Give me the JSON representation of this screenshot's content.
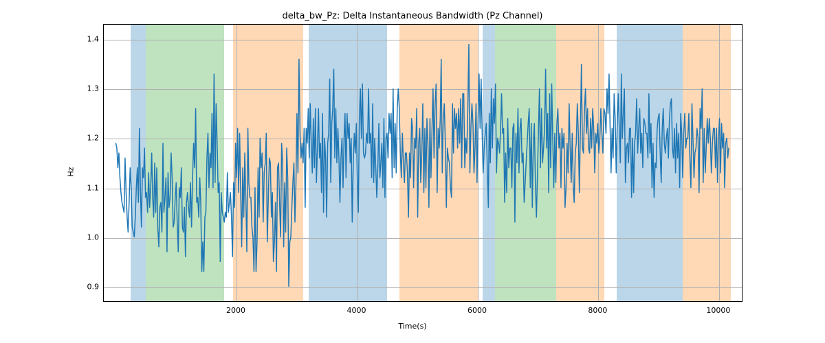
{
  "chart_data": {
    "type": "line",
    "title": "delta_bw_Pz: Delta Instantaneous Bandwidth (Pz Channel)",
    "xlabel": "Time(s)",
    "ylabel": "Hz",
    "xlim": [
      -200,
      10400
    ],
    "ylim": [
      0.87,
      1.43
    ],
    "x_ticks": [
      2000,
      4000,
      6000,
      8000,
      10000
    ],
    "y_ticks": [
      0.9,
      1.0,
      1.1,
      1.2,
      1.3,
      1.4
    ],
    "grid": true,
    "bands": [
      {
        "color": "#1f77b4",
        "x0": 250,
        "x1": 500
      },
      {
        "color": "#2ca02c",
        "x0": 500,
        "x1": 1800
      },
      {
        "color": "#ff7f0e",
        "x0": 1940,
        "x1": 3100
      },
      {
        "color": "#1f77b4",
        "x0": 3200,
        "x1": 4500
      },
      {
        "color": "#ff7f0e",
        "x0": 4700,
        "x1": 6000
      },
      {
        "color": "#1f77b4",
        "x0": 6080,
        "x1": 6280
      },
      {
        "color": "#2ca02c",
        "x0": 6280,
        "x1": 7300
      },
      {
        "color": "#ff7f0e",
        "x0": 7300,
        "x1": 8100
      },
      {
        "color": "#1f77b4",
        "x0": 8300,
        "x1": 9400
      },
      {
        "color": "#ff7f0e",
        "x0": 9400,
        "x1": 10200
      }
    ],
    "series": [
      {
        "name": "delta_bw_Pz",
        "color": "#1f77b4",
        "x_start": 0,
        "x_step": 17,
        "values": [
          1.19,
          1.18,
          1.14,
          1.17,
          1.12,
          1.09,
          1.07,
          1.06,
          1.05,
          1.16,
          1.09,
          1.04,
          1.01,
          1.07,
          1.14,
          1.1,
          1.02,
          1.01,
          1.0,
          1.04,
          1.1,
          1.14,
          1.07,
          1.22,
          1.1,
          1.02,
          1.14,
          1.12,
          1.18,
          1.08,
          1.09,
          1.05,
          1.13,
          1.06,
          1.1,
          1.17,
          1.08,
          1.04,
          1.15,
          1.05,
          1.14,
          1.02,
          0.98,
          1.06,
          1.07,
          1.01,
          1.19,
          1.05,
          1.08,
          1.12,
          0.97,
          1.13,
          1.06,
          1.08,
          1.17,
          1.12,
          1.02,
          1.03,
          1.08,
          1.11,
          1.03,
          0.97,
          1.1,
          1.08,
          1.14,
          1.02,
          1.01,
          1.06,
          0.96,
          1.07,
          1.09,
          1.06,
          1.04,
          1.11,
          1.02,
          1.12,
          1.19,
          1.14,
          1.26,
          1.07,
          1.08,
          1.04,
          1.12,
          1.07,
          0.93,
          0.99,
          0.93,
          1.04,
          1.05,
          1.16,
          1.21,
          1.1,
          1.17,
          1.14,
          1.25,
          1.1,
          1.33,
          1.11,
          1.27,
          1.19,
          1.09,
          1.11,
          0.95,
          1.09,
          1.05,
          1.04,
          1.03,
          1.05,
          1.04,
          1.13,
          1.05,
          1.07,
          1.09,
          1.04,
          0.96,
          1.11,
          1.06,
          1.19,
          1.12,
          1.22,
          1.09,
          1.21,
          1.09,
          0.98,
          1.14,
          1.04,
          1.17,
          1.08,
          0.97,
          1.22,
          1.11,
          1.08,
          1.08,
          1.02,
          1.0,
          0.93,
          1.1,
          0.93,
          0.99,
          1.14,
          1.04,
          1.2,
          1.14,
          1.17,
          1.03,
          1.13,
          1.15,
          1.21,
          0.99,
          1.08,
          1.16,
          1.15,
          1.04,
          1.09,
          0.95,
          0.99,
          1.07,
          0.93,
          1.14,
          1.15,
          1.07,
          1.0,
          1.19,
          1.15,
          0.98,
          1.11,
          1.01,
          1.18,
          1.12,
          0.9,
          0.99,
          1.0,
          1.06,
          1.11,
          1.15,
          1.03,
          1.11,
          1.25,
          1.13,
          1.36,
          1.21,
          1.16,
          1.19,
          1.15,
          1.22,
          1.06,
          1.22,
          1.19,
          1.26,
          1.16,
          1.27,
          1.19,
          1.13,
          1.24,
          1.14,
          1.26,
          1.11,
          1.18,
          1.26,
          1.16,
          1.19,
          1.09,
          1.25,
          1.05,
          1.2,
          1.16,
          1.04,
          1.19,
          1.21,
          1.32,
          1.11,
          1.23,
          1.26,
          1.34,
          1.16,
          1.26,
          1.15,
          1.22,
          1.16,
          1.07,
          1.16,
          1.2,
          1.1,
          1.2,
          1.25,
          1.12,
          1.25,
          1.2,
          1.23,
          1.15,
          1.2,
          1.03,
          1.15,
          1.21,
          1.17,
          1.23,
          1.12,
          1.05,
          1.24,
          1.3,
          1.2,
          1.31,
          1.17,
          1.16,
          1.17,
          1.21,
          1.19,
          1.3,
          1.19,
          1.21,
          1.12,
          1.27,
          1.11,
          1.2,
          1.14,
          1.08,
          1.14,
          1.23,
          1.12,
          1.15,
          1.19,
          1.1,
          1.24,
          1.08,
          1.2,
          1.21,
          1.16,
          1.25,
          1.21,
          1.25,
          1.12,
          1.3,
          1.14,
          1.23,
          1.13,
          1.26,
          1.3,
          1.26,
          1.17,
          1.12,
          1.21,
          1.15,
          1.11,
          1.17,
          1.17,
          1.13,
          1.04,
          1.17,
          1.12,
          1.24,
          1.22,
          1.1,
          1.2,
          1.18,
          1.26,
          1.04,
          1.19,
          1.22,
          1.11,
          1.17,
          1.27,
          1.09,
          1.22,
          1.1,
          1.24,
          1.19,
          1.06,
          1.24,
          1.12,
          1.22,
          1.3,
          1.16,
          1.27,
          1.31,
          1.09,
          1.22,
          1.18,
          1.24,
          1.36,
          1.13,
          1.24,
          1.27,
          1.19,
          1.06,
          1.18,
          1.16,
          1.15,
          1.1,
          1.08,
          1.27,
          1.17,
          1.26,
          1.22,
          1.25,
          1.18,
          1.26,
          1.19,
          1.28,
          1.14,
          1.29,
          1.29,
          1.14,
          1.2,
          1.17,
          1.26,
          1.39,
          1.13,
          1.22,
          1.27,
          1.23,
          1.13,
          1.18,
          1.27,
          1.11,
          1.23,
          1.33,
          1.22,
          1.32,
          1.21,
          1.13,
          1.18,
          1.21,
          1.23,
          1.14,
          1.06,
          1.25,
          1.15,
          1.3,
          1.18,
          1.28,
          1.23,
          1.31,
          1.13,
          1.2,
          1.19,
          1.17,
          1.22,
          1.29,
          1.21,
          1.22,
          1.07,
          1.17,
          1.09,
          1.24,
          1.14,
          1.18,
          1.18,
          1.1,
          1.22,
          1.23,
          1.03,
          1.21,
          1.15,
          1.26,
          1.13,
          1.22,
          1.24,
          1.15,
          1.17,
          1.07,
          1.11,
          1.15,
          1.19,
          1.23,
          1.26,
          1.1,
          1.23,
          1.06,
          1.19,
          1.23,
          1.11,
          1.04,
          1.12,
          1.21,
          1.3,
          1.14,
          1.26,
          1.15,
          1.18,
          1.22,
          1.34,
          1.18,
          1.25,
          1.09,
          1.29,
          1.14,
          1.31,
          1.2,
          1.1,
          1.21,
          1.11,
          1.23,
          1.26,
          1.18,
          1.21,
          1.1,
          1.22,
          1.18,
          1.21,
          1.06,
          1.1,
          1.19,
          1.13,
          1.27,
          1.18,
          1.11,
          1.21,
          1.1,
          1.07,
          1.17,
          1.19,
          1.27,
          1.21,
          1.09,
          1.22,
          1.35,
          1.18,
          1.17,
          1.26,
          1.3,
          1.21,
          1.26,
          1.18,
          1.17,
          1.24,
          1.18,
          1.26,
          1.22,
          1.13,
          1.21,
          1.19,
          1.23,
          1.17,
          1.2,
          1.26,
          1.21,
          1.17,
          1.26,
          1.25,
          1.21,
          1.3,
          1.25,
          1.33,
          1.23,
          1.13,
          1.22,
          1.16,
          1.29,
          1.24,
          1.13,
          1.23,
          1.29,
          1.22,
          1.15,
          1.33,
          1.2,
          1.25,
          1.3,
          1.11,
          1.18,
          1.19,
          1.15,
          1.22,
          1.22,
          1.08,
          1.2,
          1.09,
          1.19,
          1.21,
          1.28,
          1.17,
          1.22,
          1.26,
          1.17,
          1.21,
          1.14,
          1.24,
          1.23,
          1.21,
          1.21,
          1.16,
          1.29,
          1.17,
          1.23,
          1.1,
          1.19,
          1.08,
          1.15,
          1.14,
          1.22,
          1.24,
          1.25,
          1.17,
          1.11,
          1.22,
          1.26,
          1.19,
          1.17,
          1.2,
          1.22,
          1.16,
          1.24,
          1.27,
          1.28,
          1.18,
          1.16,
          1.22,
          1.13,
          1.23,
          1.16,
          1.21,
          1.1,
          1.25,
          1.21,
          1.12,
          1.21,
          1.25,
          1.18,
          1.2,
          1.2,
          1.25,
          1.16,
          1.1,
          1.27,
          1.2,
          1.12,
          1.17,
          1.18,
          1.22,
          1.2,
          1.09,
          1.26,
          1.22,
          1.3,
          1.11,
          1.22,
          1.13,
          1.18,
          1.24,
          1.19,
          1.24,
          1.2,
          1.13,
          1.19,
          1.22,
          1.22,
          1.14,
          1.22,
          1.11,
          1.2,
          1.24,
          1.13,
          1.23,
          1.18,
          1.21,
          1.1,
          1.19,
          1.2,
          1.16,
          1.18
        ]
      }
    ]
  }
}
